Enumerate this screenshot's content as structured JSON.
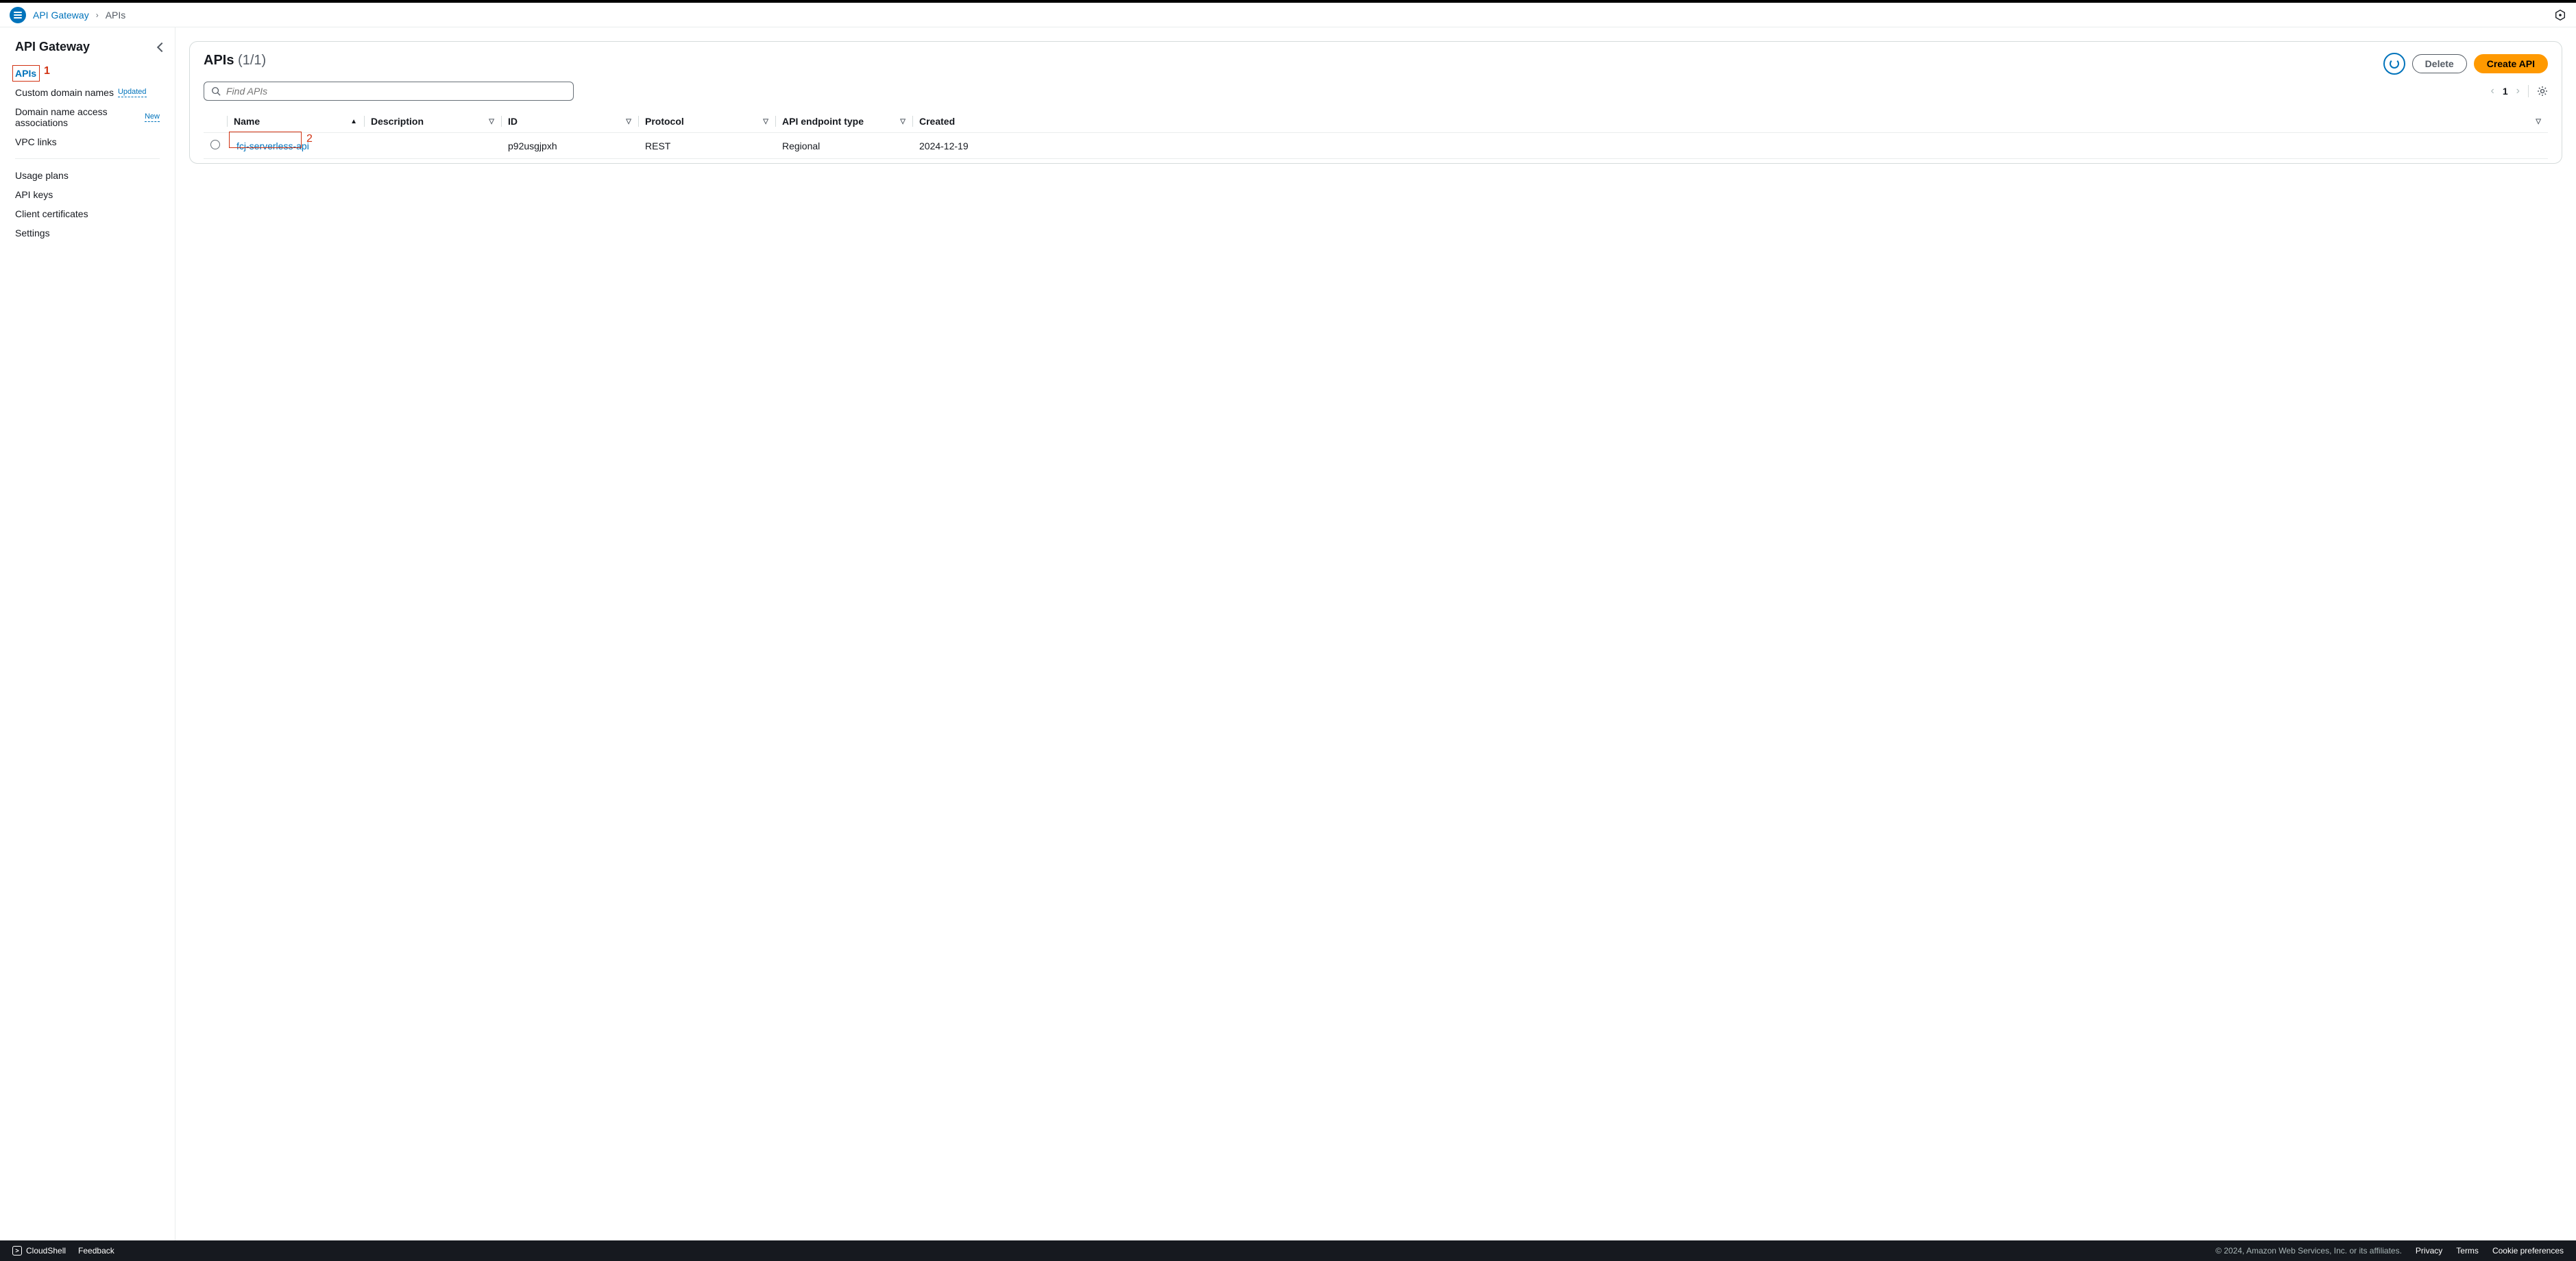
{
  "breadcrumb": {
    "service": "API Gateway",
    "page": "APIs"
  },
  "sidebar": {
    "title": "API Gateway",
    "items": [
      {
        "label": "APIs",
        "active": true
      },
      {
        "label": "Custom domain names",
        "badge": "Updated"
      },
      {
        "label": "Domain name access associations",
        "badge": "New"
      },
      {
        "label": "VPC links"
      }
    ],
    "items2": [
      {
        "label": "Usage plans"
      },
      {
        "label": "API keys"
      },
      {
        "label": "Client certificates"
      },
      {
        "label": "Settings"
      }
    ]
  },
  "panel": {
    "title": "APIs",
    "count": "(1/1)",
    "delete_label": "Delete",
    "create_label": "Create API"
  },
  "search": {
    "placeholder": "Find APIs"
  },
  "pager": {
    "page": "1"
  },
  "table": {
    "columns": {
      "name": "Name",
      "description": "Description",
      "id": "ID",
      "protocol": "Protocol",
      "endpoint_type": "API endpoint type",
      "created": "Created"
    },
    "rows": [
      {
        "name": "fcj-serverless-api",
        "description": "",
        "id": "p92usgjpxh",
        "protocol": "REST",
        "endpoint_type": "Regional",
        "created": "2024-12-19"
      }
    ]
  },
  "annotations": {
    "one": "1",
    "two": "2"
  },
  "footer": {
    "cloudshell": "CloudShell",
    "feedback": "Feedback",
    "copyright": "© 2024, Amazon Web Services, Inc. or its affiliates.",
    "privacy": "Privacy",
    "terms": "Terms",
    "cookies": "Cookie preferences"
  }
}
